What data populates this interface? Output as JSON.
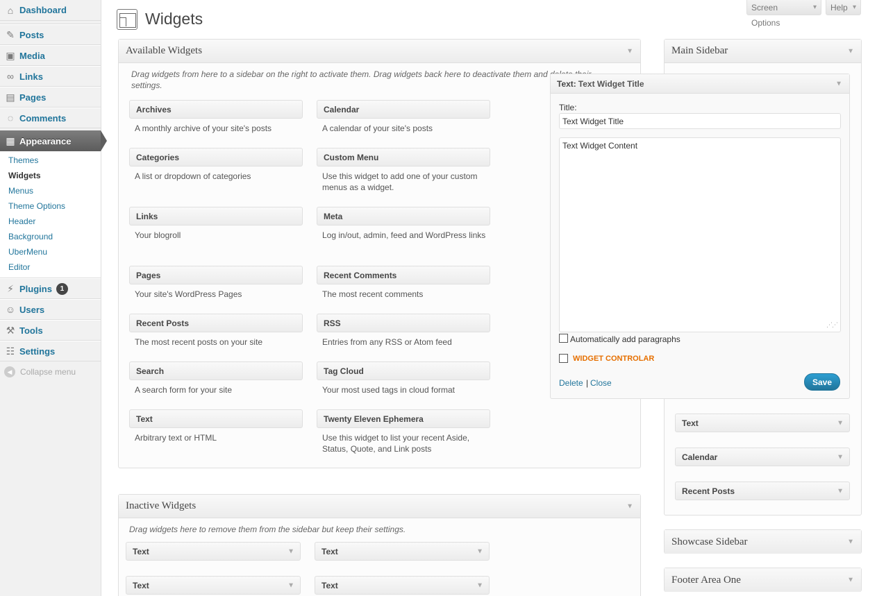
{
  "menu": {
    "items": [
      {
        "label": "Dashboard",
        "icon": "dashboard-icon"
      },
      {
        "label": "Posts",
        "icon": "pin-icon"
      },
      {
        "label": "Media",
        "icon": "media-icon"
      },
      {
        "label": "Links",
        "icon": "link-icon"
      },
      {
        "label": "Pages",
        "icon": "pages-icon"
      },
      {
        "label": "Comments",
        "icon": "comment-icon"
      },
      {
        "label": "Appearance",
        "icon": "appearance-icon"
      }
    ],
    "submenu": [
      "Themes",
      "Widgets",
      "Menus",
      "Theme Options",
      "Header",
      "Background",
      "UberMenu",
      "Editor"
    ],
    "lower_items": [
      {
        "label": "Plugins",
        "icon": "plugin-icon"
      },
      {
        "label": "Users",
        "icon": "users-icon"
      },
      {
        "label": "Tools",
        "icon": "tools-icon"
      },
      {
        "label": "Settings",
        "icon": "settings-icon"
      }
    ],
    "plugins_badge": "1",
    "collapse": "Collapse menu"
  },
  "screen_options": "Screen Options",
  "help": "Help",
  "page_title": "Widgets",
  "available": {
    "title": "Available Widgets",
    "description": "Drag widgets from here to a sidebar on the right to activate them. Drag widgets back here to deactivate them and delete their settings.",
    "widgets": [
      {
        "name": "Archives",
        "desc": "A monthly archive of your site's posts"
      },
      {
        "name": "Calendar",
        "desc": "A calendar of your site's posts"
      },
      {
        "name": "Categories",
        "desc": "A list or dropdown of categories"
      },
      {
        "name": "Custom Menu",
        "desc": "Use this widget to add one of your custom menus as a widget."
      },
      {
        "name": "Links",
        "desc": "Your blogroll"
      },
      {
        "name": "Meta",
        "desc": "Log in/out, admin, feed and WordPress links"
      },
      {
        "name": "Pages",
        "desc": "Your site's WordPress Pages"
      },
      {
        "name": "Recent Comments",
        "desc": "The most recent comments"
      },
      {
        "name": "Recent Posts",
        "desc": "The most recent posts on your site"
      },
      {
        "name": "RSS",
        "desc": "Entries from any RSS or Atom feed"
      },
      {
        "name": "Search",
        "desc": "A search form for your site"
      },
      {
        "name": "Tag Cloud",
        "desc": "Your most used tags in cloud format"
      },
      {
        "name": "Text",
        "desc": "Arbitrary text or HTML"
      },
      {
        "name": "Twenty Eleven Ephemera",
        "desc": "Use this widget to list your recent Aside, Status, Quote, and Link posts"
      }
    ]
  },
  "inactive": {
    "title": "Inactive Widgets",
    "description": "Drag widgets here to remove them from the sidebar but keep their settings.",
    "widgets": [
      "Text",
      "Text",
      "Text",
      "Text"
    ]
  },
  "main_sidebar": {
    "title": "Main Sidebar",
    "widgets": [
      "Text",
      "Calendar",
      "Recent Posts"
    ]
  },
  "open_widget": {
    "type": "Text:",
    "title": "Text Widget Title",
    "title_label": "Title:",
    "title_value": "Text Widget Title",
    "content": "Text Widget Content",
    "auto_paragraphs": "Automatically add paragraphs",
    "widget_controlar": "WIDGET CONTROLAR",
    "delete": "Delete",
    "separator": "|",
    "close": "Close",
    "save": "Save"
  },
  "showcase_sidebar": "Showcase Sidebar",
  "footer_area_one": "Footer Area One"
}
